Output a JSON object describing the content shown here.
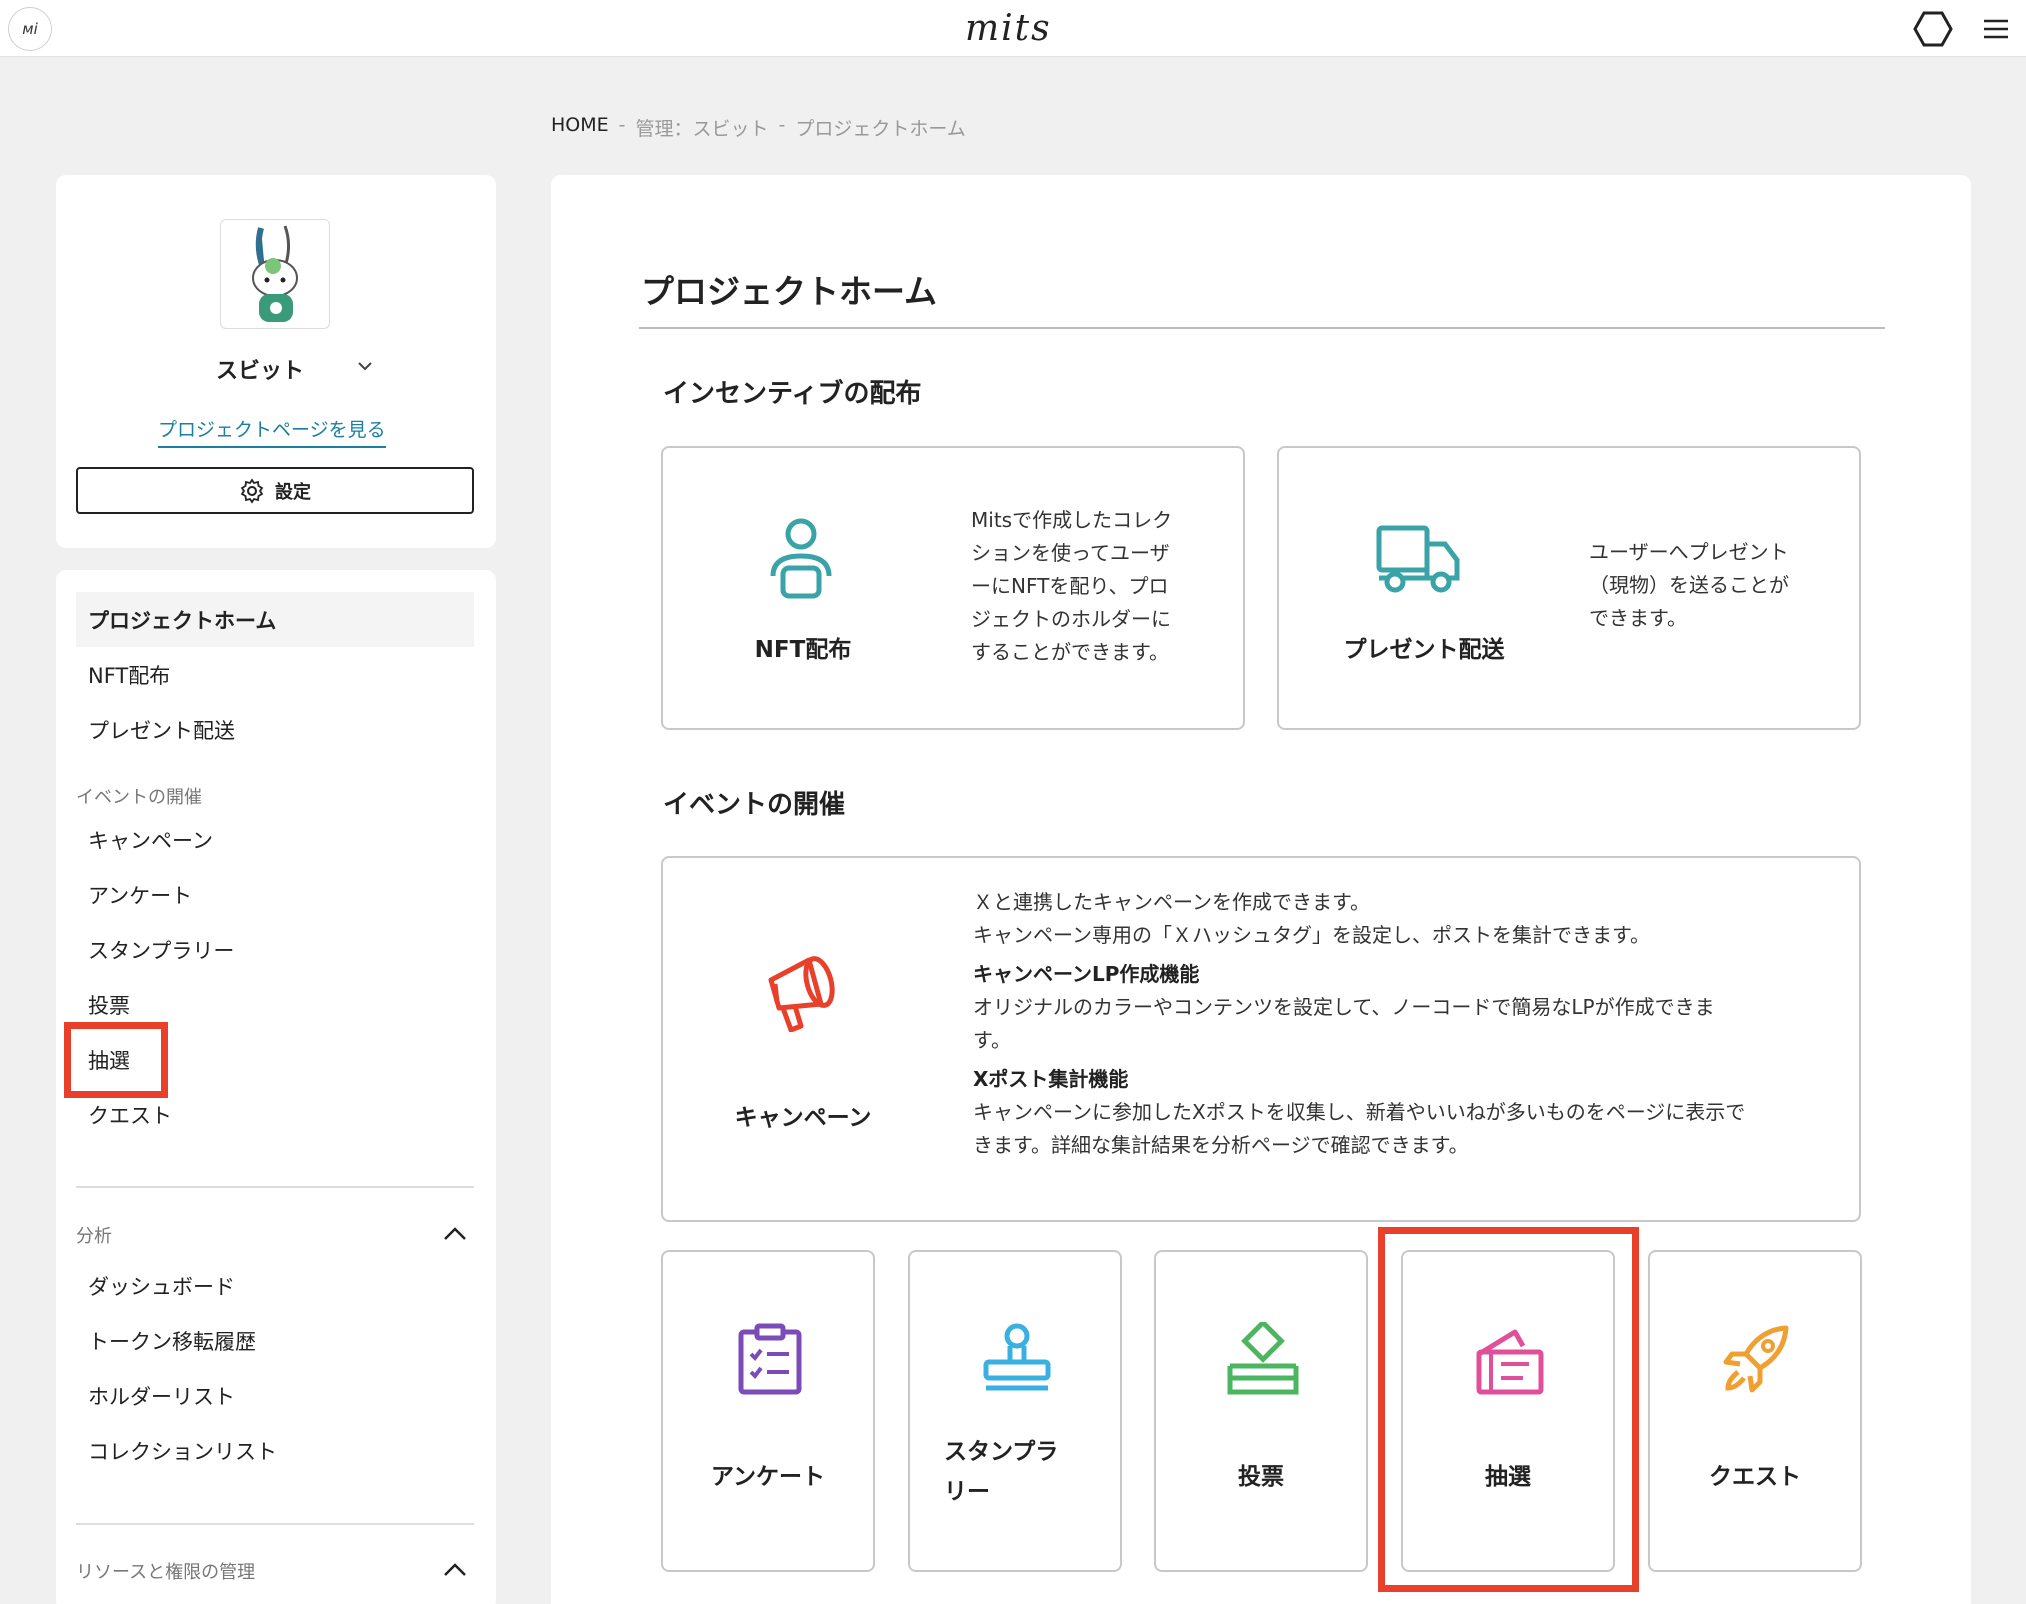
{
  "header": {
    "avatar_text": "мi",
    "logo": "mits"
  },
  "breadcrumb": {
    "home": "HOME",
    "sep1": "-",
    "item1": "管理：スビット",
    "sep2": "-",
    "item2": "プロジェクトホーム"
  },
  "sidebar": {
    "project_name": "スビット",
    "project_link": "プロジェクトページを見る",
    "settings_label": "設定",
    "items": {
      "home": "プロジェクトホーム",
      "nft": "NFT配布",
      "present": "プレゼント配送",
      "event_section": "イベントの開催",
      "campaign": "キャンペーン",
      "survey": "アンケート",
      "stamp": "スタンプラリー",
      "vote": "投票",
      "lottery": "抽選",
      "quest": "クエスト",
      "analysis_section": "分析",
      "dashboard": "ダッシュボード",
      "token_history": "トークン移転履歴",
      "holder_list": "ホルダーリスト",
      "collection_list": "コレクションリスト",
      "resource_section": "リソースと権限の管理"
    }
  },
  "main": {
    "title": "プロジェクトホーム",
    "incentive_title": "インセンティブの配布",
    "nft_tile": {
      "label": "NFT配布",
      "desc_lines": [
        "Mitsで作成したコレク",
        "ションを使ってユーザ",
        "ーにNFTを配り、プロ",
        "ジェクトのホルダーに",
        "することができます。"
      ]
    },
    "present_tile": {
      "label": "プレゼント配送",
      "desc_lines": [
        "ユーザーへプレゼント",
        "（現物）を送ることが",
        "できます。"
      ]
    },
    "event_title": "イベントの開催",
    "campaign_tile": {
      "label": "キャンペーン",
      "line1": "Ｘと連携したキャンペーンを作成できます。",
      "line2": "キャンペーン専用の「Ｘハッシュタグ」を設定し、ポストを集計できます。",
      "feature1_title": "キャンペーンLP作成機能",
      "feature1_line1": "オリジナルのカラーやコンテンツを設定して、ノーコードで簡易なLPが作成できま",
      "feature1_line2": "す。",
      "feature2_title": "Xポスト集計機能",
      "feature2_line1": "キャンペーンに参加したXポストを収集し、新着やいいねが多いものをページに表示で",
      "feature2_line2": "きます。詳細な集計結果を分析ページで確認できます。"
    },
    "small_tiles": {
      "survey": "アンケート",
      "stamp_line1": "スタンプラ",
      "stamp_line2": "リー",
      "vote": "投票",
      "lottery": "抽選",
      "quest": "クエスト"
    }
  },
  "colors": {
    "highlight": "#e8402b",
    "teal_icon": "#3aa3a7",
    "campaign_icon": "#e8402b",
    "survey_icon": "#7b4bb7",
    "stamp_icon": "#3ab0e0",
    "vote_icon": "#4bb560",
    "lottery_icon": "#e0509a",
    "quest_icon": "#f0a030"
  }
}
